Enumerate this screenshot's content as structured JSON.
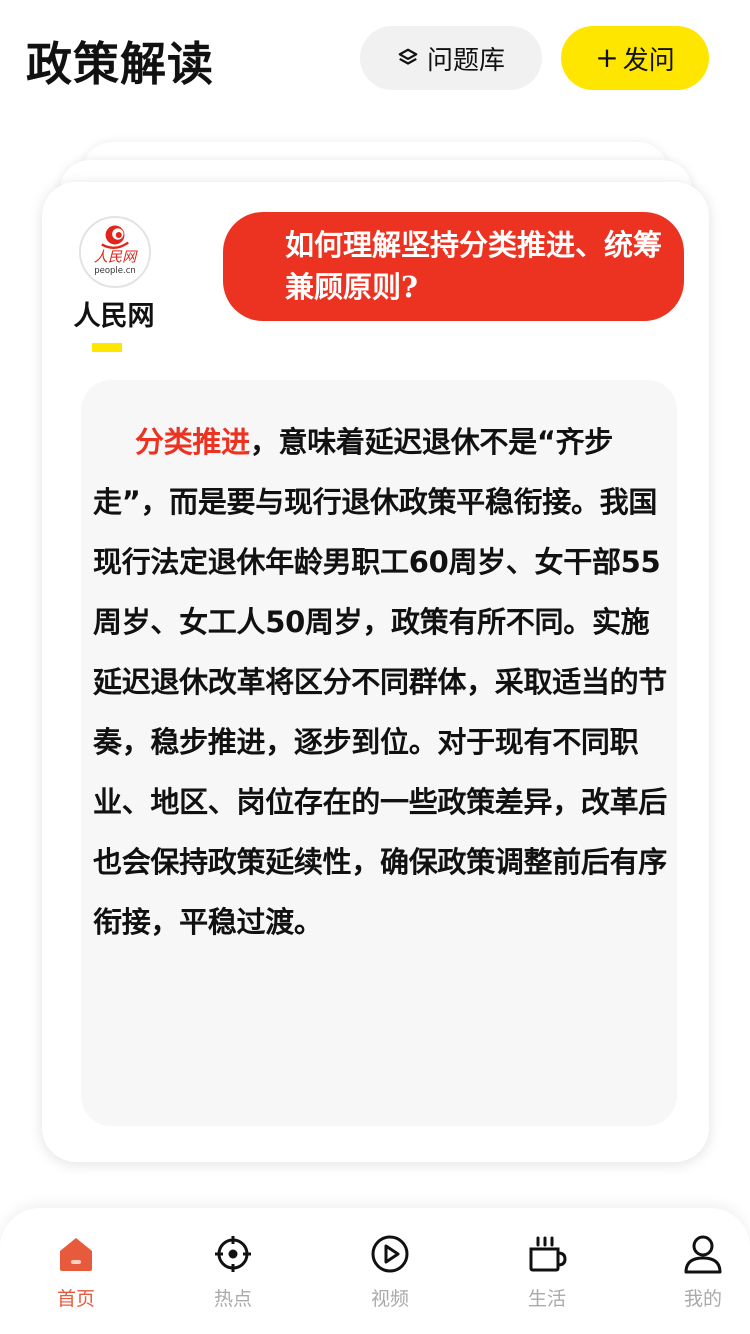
{
  "header": {
    "title": "政策解读",
    "library_label": "问题库",
    "ask_plus": "+",
    "ask_label": "发问"
  },
  "card": {
    "source": {
      "name": "人民网",
      "logo_text": "人民网",
      "logo_domain": "people.cn"
    },
    "question": "如何理解坚持分类推进、统筹兼顾原则?",
    "answer_lead": "分类推进",
    "answer_body": "，意味着延迟退休不是“齐步走”，而是要与现行退休政策平稳衔接。我国现行法定退休年龄男职工60周岁、女干部55周岁、女工人50周岁，政策有所不同。实施延迟退休改革将区分不同群体，采取适当的节奏，稳步推进，逐步到位。对于现有不同职业、地区、岗位存在的一些政策差异，改革后也会保持政策延续性，确保政策调整前后有序衔接，平稳过渡。"
  },
  "tabbar": {
    "items": [
      {
        "label": "首页",
        "icon": "home-icon",
        "active": true
      },
      {
        "label": "热点",
        "icon": "crosshair-icon",
        "active": false
      },
      {
        "label": "视频",
        "icon": "play-circle-icon",
        "active": false
      },
      {
        "label": "生活",
        "icon": "coffee-cup-icon",
        "active": false
      },
      {
        "label": "我的",
        "icon": "user-icon",
        "active": false
      }
    ]
  },
  "colors": {
    "accent_yellow": "#ffe600",
    "question_red": "#ec3221",
    "active_tab": "#e85a3c",
    "inactive_tab": "#aaaaaa"
  }
}
